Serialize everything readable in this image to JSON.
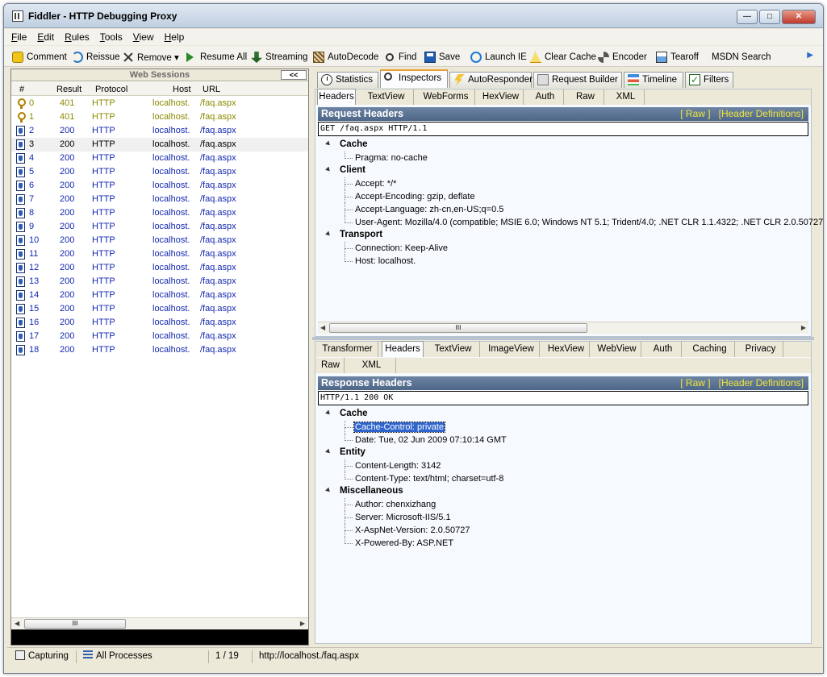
{
  "window": {
    "title": "Fiddler - HTTP Debugging Proxy",
    "minimize": "—",
    "maximize": "□",
    "close": "✕"
  },
  "menu": [
    "File",
    "Edit",
    "Rules",
    "Tools",
    "View",
    "Help"
  ],
  "toolbar": {
    "comment": "Comment",
    "reissue": "Reissue",
    "remove": "Remove ▾",
    "resume_all": "Resume All",
    "streaming": "Streaming",
    "autodecode": "AutoDecode",
    "find": "Find",
    "save": "Save",
    "launch_ie": "Launch IE",
    "clear_cache": "Clear Cache",
    "encoder": "Encoder",
    "tearoff": "Tearoff",
    "msdn_search": "MSDN Search"
  },
  "sessions": {
    "header": "Web Sessions",
    "collapse": "<<",
    "columns": {
      "num": "#",
      "result": "Result",
      "protocol": "Protocol",
      "host": "Host",
      "url": "URL"
    },
    "rows": [
      {
        "num": "0",
        "result": "401",
        "protocol": "HTTP",
        "host": "localhost.",
        "url": "/faq.aspx",
        "icon": "lock-icon",
        "color": "olive"
      },
      {
        "num": "1",
        "result": "401",
        "protocol": "HTTP",
        "host": "localhost.",
        "url": "/faq.aspx",
        "icon": "lock-icon",
        "color": "olive"
      },
      {
        "num": "2",
        "result": "200",
        "protocol": "HTTP",
        "host": "localhost.",
        "url": "/faq.aspx",
        "icon": "page-icon",
        "color": "blue"
      },
      {
        "num": "3",
        "result": "200",
        "protocol": "HTTP",
        "host": "localhost.",
        "url": "/faq.aspx",
        "icon": "page-icon",
        "color": "black"
      },
      {
        "num": "4",
        "result": "200",
        "protocol": "HTTP",
        "host": "localhost.",
        "url": "/faq.aspx",
        "icon": "page-icon",
        "color": "blue"
      },
      {
        "num": "5",
        "result": "200",
        "protocol": "HTTP",
        "host": "localhost.",
        "url": "/faq.aspx",
        "icon": "page-icon",
        "color": "blue"
      },
      {
        "num": "6",
        "result": "200",
        "protocol": "HTTP",
        "host": "localhost.",
        "url": "/faq.aspx",
        "icon": "page-icon",
        "color": "blue"
      },
      {
        "num": "7",
        "result": "200",
        "protocol": "HTTP",
        "host": "localhost.",
        "url": "/faq.aspx",
        "icon": "page-icon",
        "color": "blue"
      },
      {
        "num": "8",
        "result": "200",
        "protocol": "HTTP",
        "host": "localhost.",
        "url": "/faq.aspx",
        "icon": "page-icon",
        "color": "blue"
      },
      {
        "num": "9",
        "result": "200",
        "protocol": "HTTP",
        "host": "localhost.",
        "url": "/faq.aspx",
        "icon": "page-icon",
        "color": "blue"
      },
      {
        "num": "10",
        "result": "200",
        "protocol": "HTTP",
        "host": "localhost.",
        "url": "/faq.aspx",
        "icon": "page-icon",
        "color": "blue"
      },
      {
        "num": "11",
        "result": "200",
        "protocol": "HTTP",
        "host": "localhost.",
        "url": "/faq.aspx",
        "icon": "page-icon",
        "color": "blue"
      },
      {
        "num": "12",
        "result": "200",
        "protocol": "HTTP",
        "host": "localhost.",
        "url": "/faq.aspx",
        "icon": "page-icon",
        "color": "blue"
      },
      {
        "num": "13",
        "result": "200",
        "protocol": "HTTP",
        "host": "localhost.",
        "url": "/faq.aspx",
        "icon": "page-icon",
        "color": "blue"
      },
      {
        "num": "14",
        "result": "200",
        "protocol": "HTTP",
        "host": "localhost.",
        "url": "/faq.aspx",
        "icon": "page-icon",
        "color": "blue"
      },
      {
        "num": "15",
        "result": "200",
        "protocol": "HTTP",
        "host": "localhost.",
        "url": "/faq.aspx",
        "icon": "page-icon",
        "color": "blue"
      },
      {
        "num": "16",
        "result": "200",
        "protocol": "HTTP",
        "host": "localhost.",
        "url": "/faq.aspx",
        "icon": "page-icon",
        "color": "blue"
      },
      {
        "num": "17",
        "result": "200",
        "protocol": "HTTP",
        "host": "localhost.",
        "url": "/faq.aspx",
        "icon": "page-icon",
        "color": "blue"
      },
      {
        "num": "18",
        "result": "200",
        "protocol": "HTTP",
        "host": "localhost.",
        "url": "/faq.aspx",
        "icon": "page-icon",
        "color": "blue"
      }
    ],
    "selected_index": 3,
    "scroll_thumb": "III"
  },
  "main_tabs": [
    {
      "label": "Statistics",
      "icon": "statistics-icon"
    },
    {
      "label": "Inspectors",
      "icon": "inspectors-icon",
      "active": true
    },
    {
      "label": "AutoResponder",
      "icon": "autoresponder-icon"
    },
    {
      "label": "Request Builder",
      "icon": "request-builder-icon"
    },
    {
      "label": "Timeline",
      "icon": "timeline-icon"
    },
    {
      "label": "Filters",
      "icon": "filters-icon"
    }
  ],
  "request": {
    "tabs": [
      "Headers",
      "TextView",
      "WebForms",
      "HexView",
      "Auth",
      "Raw",
      "XML"
    ],
    "active_tab": "Headers",
    "title": "Request Headers",
    "raw_link": "[ Raw ]",
    "defs_link": "[Header Definitions]",
    "first_line": "GET /faq.aspx HTTP/1.1",
    "groups": [
      {
        "name": "Cache",
        "items": [
          "Pragma: no-cache"
        ]
      },
      {
        "name": "Client",
        "items": [
          "Accept: */*",
          "Accept-Encoding: gzip, deflate",
          "Accept-Language: zh-cn,en-US;q=0.5",
          "User-Agent: Mozilla/4.0 (compatible; MSIE 6.0; Windows NT 5.1; Trident/4.0; .NET CLR 1.1.4322; .NET CLR 2.0.50727"
        ]
      },
      {
        "name": "Transport",
        "items": [
          "Connection: Keep-Alive",
          "Host: localhost."
        ]
      }
    ],
    "scroll_thumb": "III"
  },
  "response": {
    "tabs_row1": [
      "Transformer",
      "Headers",
      "TextView",
      "ImageView",
      "HexView",
      "WebView",
      "Auth",
      "Caching",
      "Privacy"
    ],
    "tabs_row2": [
      "Raw",
      "XML"
    ],
    "active_tab": "Headers",
    "title": "Response Headers",
    "raw_link": "[ Raw ]",
    "defs_link": "[Header Definitions]",
    "first_line": "HTTP/1.1 200 OK",
    "groups": [
      {
        "name": "Cache",
        "items": [
          "Cache-Control: private",
          "Date: Tue, 02 Jun 2009 07:10:14 GMT"
        ]
      },
      {
        "name": "Entity",
        "items": [
          "Content-Length: 3142",
          "Content-Type: text/html; charset=utf-8"
        ]
      },
      {
        "name": "Miscellaneous",
        "items": [
          "Author: chenxizhang",
          "Server: Microsoft-IIS/5.1",
          "X-AspNet-Version: 2.0.50727",
          "X-Powered-By: ASP.NET"
        ]
      }
    ],
    "highlighted_item": "Cache-Control: private"
  },
  "status": {
    "capturing": "Capturing",
    "processes": "All Processes",
    "count": "1 / 19",
    "url": "http://localhost./faq.aspx"
  }
}
